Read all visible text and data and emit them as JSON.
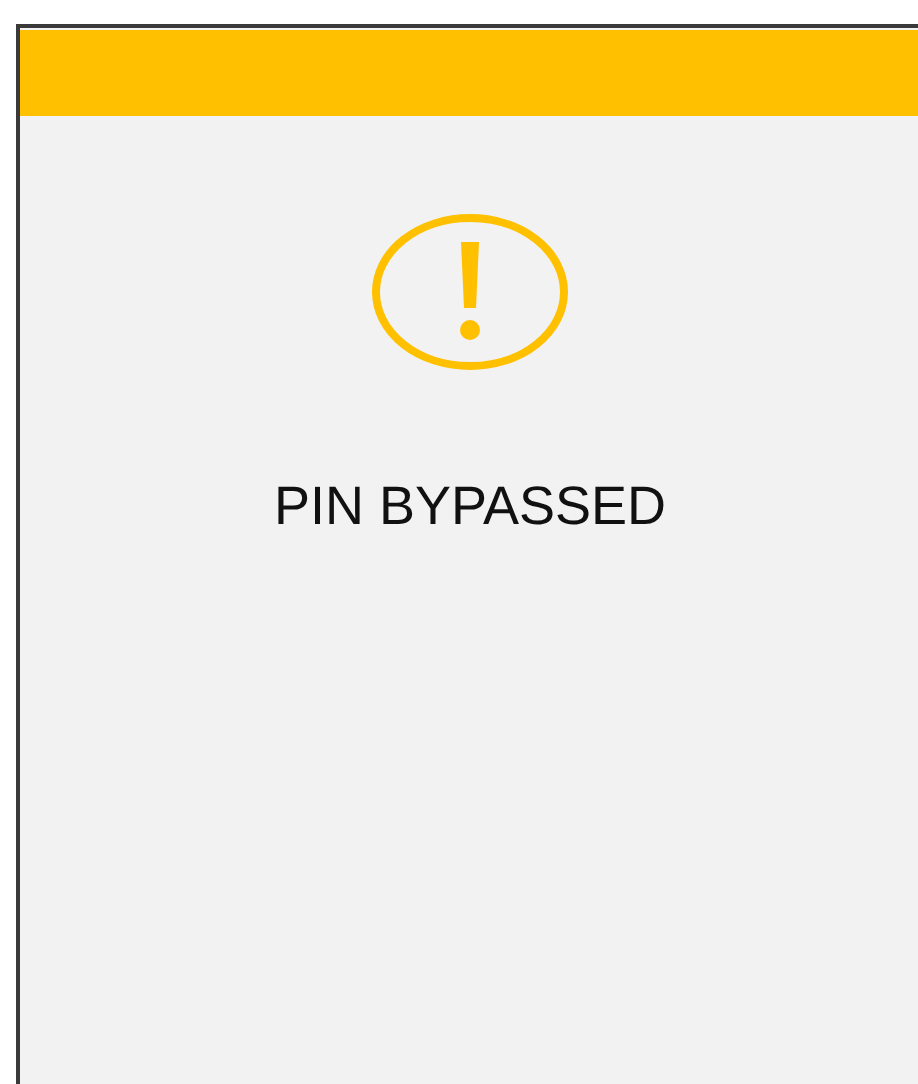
{
  "alert": {
    "message": "PIN BYPASSED"
  }
}
